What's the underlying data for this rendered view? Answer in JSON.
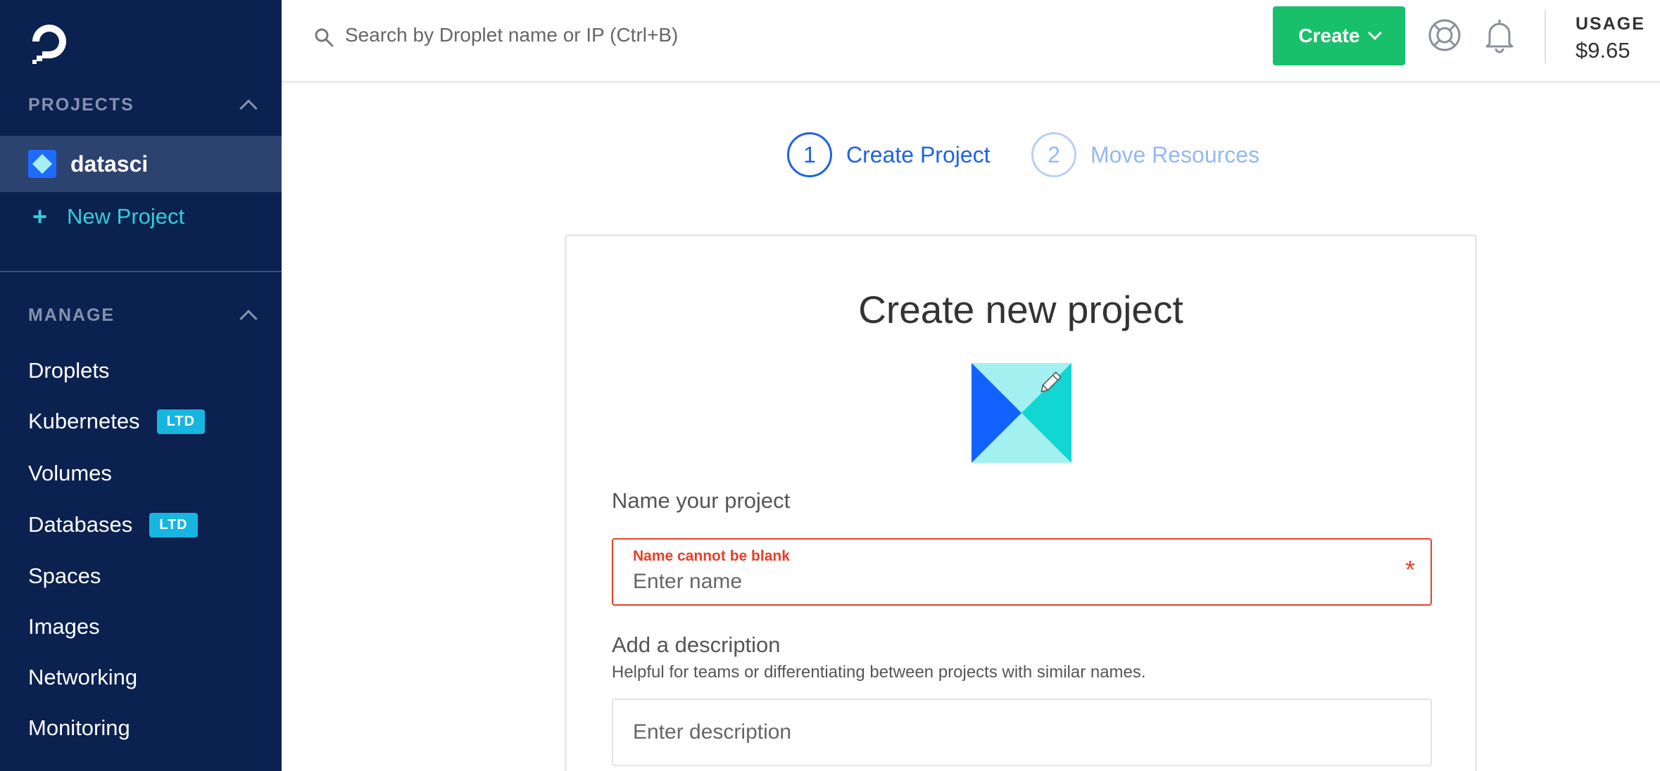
{
  "sidebar": {
    "projects_heading": "PROJECTS",
    "active_project": "datasci",
    "new_project_label": "New Project",
    "manage_heading": "MANAGE",
    "items": [
      {
        "label": "Droplets",
        "badge": ""
      },
      {
        "label": "Kubernetes",
        "badge": "LTD"
      },
      {
        "label": "Volumes",
        "badge": ""
      },
      {
        "label": "Databases",
        "badge": "LTD"
      },
      {
        "label": "Spaces",
        "badge": ""
      },
      {
        "label": "Images",
        "badge": ""
      },
      {
        "label": "Networking",
        "badge": ""
      },
      {
        "label": "Monitoring",
        "badge": ""
      }
    ]
  },
  "topbar": {
    "search_placeholder": "Search by Droplet name or IP (Ctrl+B)",
    "create_label": "Create",
    "usage_label": "USAGE",
    "usage_value": "$9.65"
  },
  "steps": [
    {
      "number": "1",
      "label": "Create Project",
      "active": true
    },
    {
      "number": "2",
      "label": "Move Resources",
      "active": false
    }
  ],
  "form": {
    "title": "Create new project",
    "name_label": "Name your project",
    "name_error": "Name cannot be blank",
    "name_placeholder": "Enter name",
    "required_marker": "*",
    "description_label": "Add a description",
    "description_help": "Helpful for teams or differentiating between projects with similar names.",
    "description_placeholder": "Enter description"
  },
  "colors": {
    "sidebar_bg": "#0b2150",
    "accent_blue": "#1e62e8",
    "create_green": "#18c06b",
    "error_red": "#e5402a",
    "new_project_teal": "#2fd0d8"
  }
}
